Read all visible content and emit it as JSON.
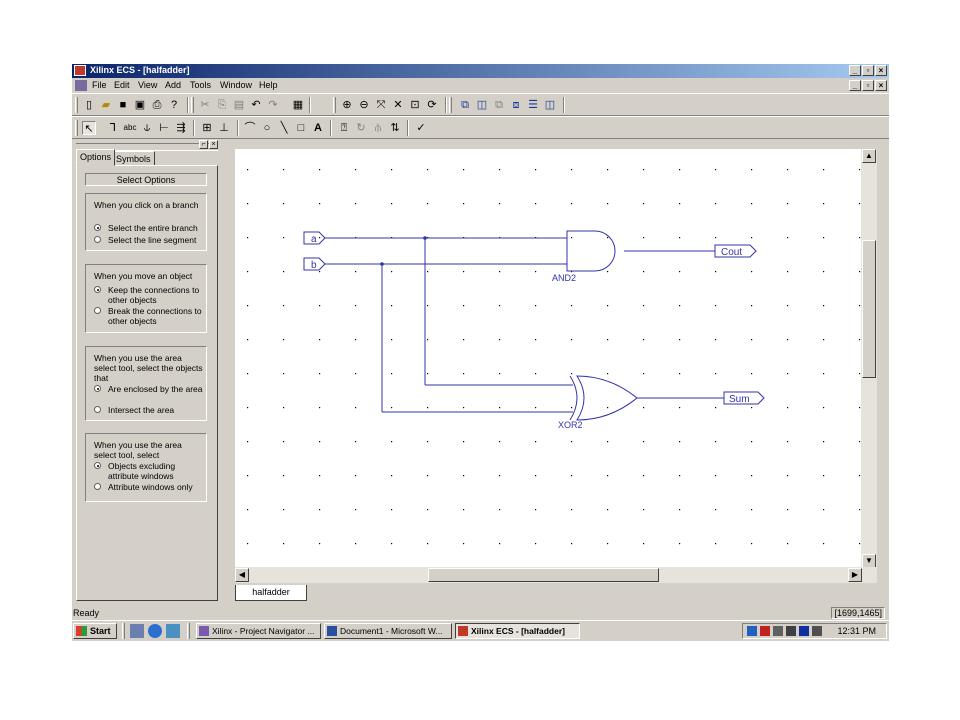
{
  "window": {
    "title": "Xilinx ECS - [halfadder]",
    "caption_buttons": [
      "_",
      "▫",
      "×"
    ],
    "mdi_buttons": [
      "_",
      "▫",
      "×"
    ]
  },
  "menu": [
    "File",
    "Edit",
    "View",
    "Add",
    "Tools",
    "Window",
    "Help"
  ],
  "toolbar_main": {
    "icons": [
      "new-icon",
      "open-icon",
      "save-icon",
      "save-all-icon",
      "print-icon",
      "help-pointer-icon",
      "cut-icon",
      "copy-icon",
      "paste-icon",
      "undo-icon",
      "redo-icon",
      "find-icon",
      "zoom-in-icon",
      "zoom-out-icon",
      "zoom-full-icon",
      "zoom-fit-icon",
      "zoom-selection-icon",
      "refresh-icon",
      "hierarchy-push-icon",
      "hierarchy-pop-icon",
      "symbol-icon",
      "sheet-icon",
      "tile-horizontal-icon",
      "tile-vertical-icon"
    ]
  },
  "toolbar_draw": {
    "icons": [
      "select-arrow-icon",
      "wire-icon",
      "net-name-icon",
      "bus-name-icon",
      "bus-tap-icon",
      "io-marker-icon",
      "add-symbol-icon",
      "add-pin-icon",
      "arc-icon",
      "circle-icon",
      "line-icon",
      "rectangle-icon",
      "text-icon",
      "attribute-icon",
      "rotate-icon",
      "mirror-icon",
      "swap-icon",
      "check-icon"
    ],
    "text_icon_label": "A"
  },
  "panel": {
    "tabs": [
      "Options",
      "Symbols"
    ],
    "header": "Select Options",
    "groups": [
      {
        "question": "When you click on a branch",
        "options": [
          {
            "label": "Select the entire branch",
            "selected": true
          },
          {
            "label": "Select the line segment",
            "selected": false
          }
        ]
      },
      {
        "question": "When you move an object",
        "options": [
          {
            "label": "Keep the connections to other objects",
            "selected": true
          },
          {
            "label": "Break the connections to other objects",
            "selected": false
          }
        ]
      },
      {
        "question": "When you use the area select tool, select the objects that",
        "options": [
          {
            "label": "Are enclosed by the area",
            "selected": true
          },
          {
            "label": "Intersect the area",
            "selected": false
          }
        ]
      },
      {
        "question": "When you use the area select tool, select",
        "options": [
          {
            "label": "Objects excluding attribute windows",
            "selected": true
          },
          {
            "label": "Attribute windows only",
            "selected": false
          }
        ]
      }
    ]
  },
  "schematic": {
    "inputs": [
      "a",
      "b"
    ],
    "outputs": [
      "Cout",
      "Sum"
    ],
    "gates": [
      "AND2",
      "XOR2"
    ],
    "wire_color": "#3333aa"
  },
  "document_tab": "halfadder",
  "status": {
    "text": "Ready",
    "coords": "[1699,1465]"
  },
  "taskbar": {
    "start": "Start",
    "tasks": [
      {
        "label": "Xilinx - Project Navigator ...",
        "active": false
      },
      {
        "label": "Document1 - Microsoft W...",
        "active": false
      },
      {
        "label": "Xilinx ECS - [halfadder]",
        "active": true
      }
    ],
    "clock": "12:31 PM"
  }
}
